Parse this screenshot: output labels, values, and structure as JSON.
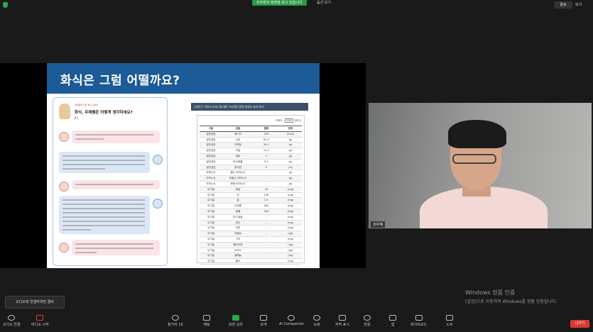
{
  "topbar": {
    "share_banner": "조부원의 화면을 보고 있습니다",
    "stop_share": "옵션 보기",
    "exit_fullscreen": "종료",
    "view": "보기"
  },
  "slide": {
    "title": "화식은 그럼 어떨까요?",
    "chat_subtitle": "반려동물 식단 체크 아이콘",
    "chat_question": "화식, 우재쌤은 어떻게 생각하세요?",
    "chat_num": "Ⅱ 1",
    "table_title": "[사료구, 이유식 조리] 웨 대한 가시적인 닭연 영양소 분석 보기",
    "filter_label": "가져가",
    "filter_value": "100",
    "filter_unit": "[보기]",
    "table_headers": [
      "구분",
      "성분",
      "함량",
      "단위"
    ],
    "table_rows": [
      [
        "일반성분",
        "에너지",
        "150",
        "(kcal)"
      ],
      [
        "일반성분",
        "수분",
        "67.4",
        "(g)"
      ],
      [
        "일반성분",
        "단백질",
        "20.1",
        "(g)"
      ],
      [
        "일반성분",
        "지질",
        "11.5",
        "(g)"
      ],
      [
        "일반성분",
        "회분",
        "1",
        "(g)"
      ],
      [
        "일반성분",
        "탄수화물",
        "0.1",
        "(g)"
      ],
      [
        "일반성분",
        "총지방",
        "5",
        "(%)"
      ],
      [
        "아미노산",
        "필수 아미노산",
        "-",
        "(g)"
      ],
      [
        "아미노산",
        "비필수 아미노산",
        "-",
        "(g)"
      ],
      [
        "아미노산",
        "총량 아미노산",
        "-",
        "(g)"
      ],
      [
        "무기질",
        "칼슘",
        "10",
        "(mg)"
      ],
      [
        "무기질",
        "인",
        "156",
        "(mg)"
      ],
      [
        "무기질",
        "철",
        "0.5",
        "(mg)"
      ],
      [
        "무기질",
        "나트륨",
        "442",
        "(mg)"
      ],
      [
        "무기질",
        "칼륨",
        "410",
        "(mg)"
      ],
      [
        "무기질",
        "마그네슘",
        "-",
        "(mg)"
      ],
      [
        "무기질",
        "망간",
        "-",
        "(mg)"
      ],
      [
        "무기질",
        "아연",
        "-",
        "(mg)"
      ],
      [
        "무기질",
        "코발트",
        "-",
        "(ug)"
      ],
      [
        "무기질",
        "구리",
        "-",
        "(mg)"
      ],
      [
        "무기질",
        "몰리브덴",
        "-",
        "(ug)"
      ],
      [
        "무기질",
        "요오드",
        "-",
        "(ug)"
      ],
      [
        "무기질",
        "셀레늄",
        "-",
        "(ug)"
      ],
      [
        "무기질",
        "불소",
        "-",
        "(mg)"
      ]
    ]
  },
  "camera": {
    "participant_name": "조우재"
  },
  "watermark": {
    "title": "Windows 정품 인증",
    "subtitle": "[설정]으로 이동하여 Windows를 정품 인증합니다."
  },
  "tooltip": "오디오에 연결하려면 클릭",
  "toolbar": {
    "audio": "오디오 연결",
    "video": "비디오 시작",
    "participants": "참가자",
    "participants_count": "15",
    "chat": "채팅",
    "share": "화면 공유",
    "summary": "요약",
    "ai": "AI Companion",
    "record": "녹화",
    "captions": "자막 표시",
    "reactions": "반응",
    "apps": "앱",
    "whiteboard": "화이트보드",
    "notes": "노트",
    "leave": "나가기"
  }
}
